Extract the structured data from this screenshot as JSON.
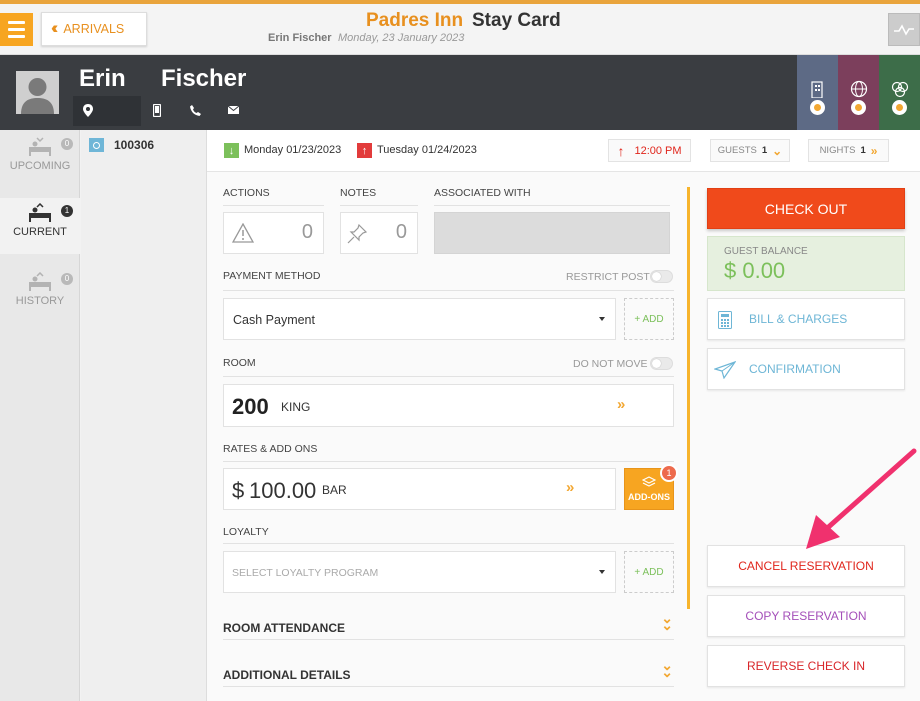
{
  "header": {
    "back_label": "ARRIVALS",
    "hotel_name": "Padres Inn",
    "page_title": "Stay Card",
    "guest_name": "Erin Fischer",
    "date": "Monday, 23 January 2023"
  },
  "guest": {
    "first_name": "Erin",
    "last_name": "Fischer"
  },
  "sidebar": {
    "items": [
      {
        "label": "UPCOMING",
        "count": "0"
      },
      {
        "label": "CURRENT",
        "count": "1"
      },
      {
        "label": "HISTORY",
        "count": "0"
      }
    ]
  },
  "reservation": {
    "number": "100306"
  },
  "stay": {
    "arrival": "Monday 01/23/2023",
    "departure": "Tuesday 01/24/2023",
    "time": "12:00 PM",
    "guests_label": "GUESTS",
    "guests": "1",
    "nights_label": "NIGHTS",
    "nights": "1"
  },
  "actions": {
    "label": "ACTIONS",
    "count": "0"
  },
  "notes": {
    "label": "NOTES",
    "count": "0"
  },
  "associated": {
    "label": "ASSOCIATED WITH"
  },
  "payment": {
    "label": "PAYMENT METHOD",
    "restrict_label": "RESTRICT POST",
    "value": "Cash Payment",
    "add_label": "+ ADD"
  },
  "room": {
    "label": "ROOM",
    "do_not_move_label": "DO NOT MOVE",
    "number": "200",
    "type": "KING"
  },
  "rates": {
    "label": "RATES & ADD ONS",
    "currency": "$",
    "amount": "100.00",
    "code": "BAR",
    "addons_label": "ADD-ONS",
    "addons_count": "1"
  },
  "loyalty": {
    "label": "LOYALTY",
    "placeholder": "SELECT LOYALTY PROGRAM",
    "add_label": "+ ADD"
  },
  "sections": {
    "room_attendance": "ROOM ATTENDANCE",
    "additional_details": "ADDITIONAL DETAILS"
  },
  "right": {
    "checkout": "CHECK OUT",
    "balance_label": "GUEST BALANCE",
    "balance": "$ 0.00",
    "bill_charges": "BILL & CHARGES",
    "confirmation": "CONFIRMATION",
    "cancel": "CANCEL RESERVATION",
    "copy": "COPY RESERVATION",
    "reverse": "REVERSE CHECK IN"
  },
  "colors": {
    "accent": "#f2a732",
    "checkout": "#f04a1b",
    "balance": "#7cc05b",
    "link": "#6eb6d6",
    "cancel": "#e0261c",
    "copy": "#a44fb9",
    "annotation_arrow": "#f0316e"
  }
}
